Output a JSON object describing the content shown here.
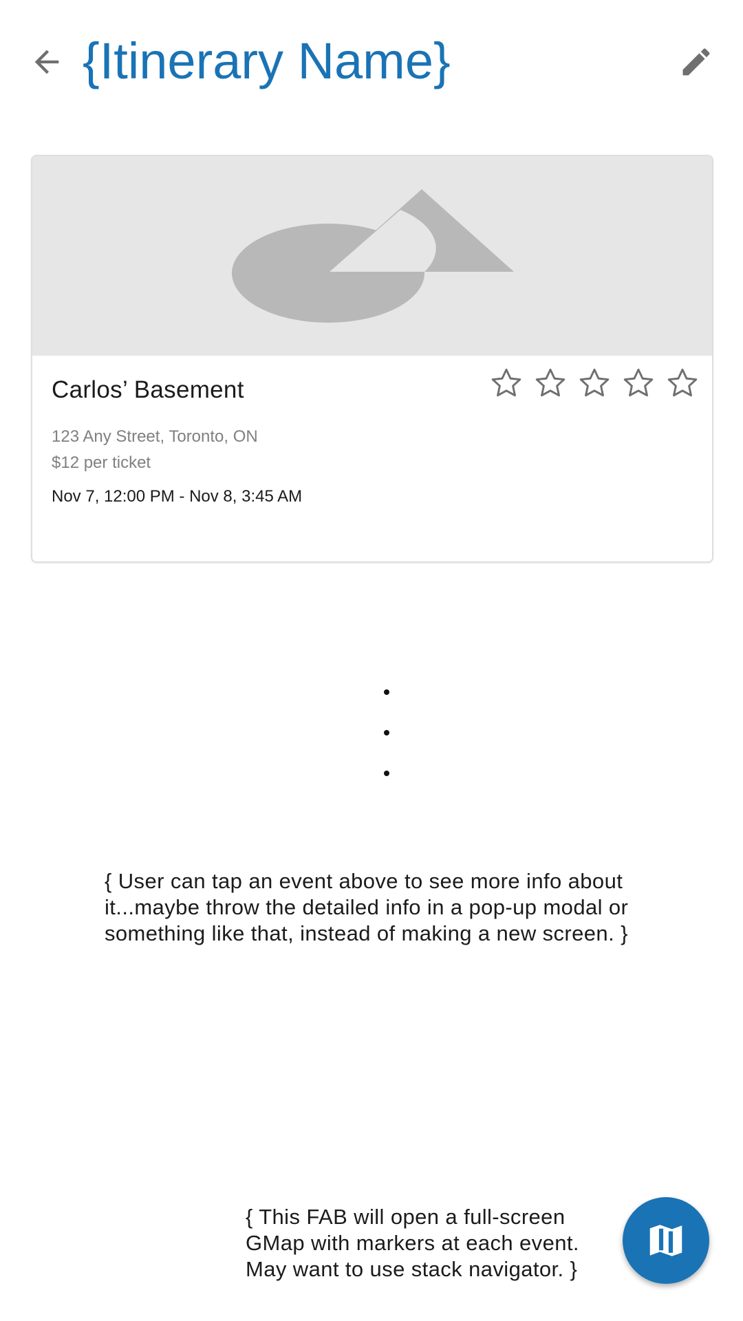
{
  "header": {
    "title": "{Itinerary Name}",
    "back_icon": "arrow-back-icon",
    "edit_icon": "pencil-icon"
  },
  "event_card": {
    "name": "Carlos’ Basement",
    "address": "123 Any Street, Toronto, ON",
    "price": "$12 per ticket",
    "dates": "Nov 7, 12:00 PM - Nov 8, 3:45 AM",
    "rating": {
      "value": 0,
      "max": 5
    },
    "media_icon": "image-placeholder-icon"
  },
  "notes": {
    "tap_event": "{ User can tap an event above to see more info about it...maybe throw the detailed info in a pop-up modal or something like that, instead of making a new screen. }",
    "fab": "{ This FAB will open a full-screen GMap with markers at each event. May want to use stack navigator. }"
  },
  "fab": {
    "icon": "map-icon"
  },
  "colors": {
    "accent": "#1a73b5",
    "icon_gray": "#6f6f6f",
    "placeholder_bg": "#e6e6e6",
    "placeholder_shape": "#b8b8b8"
  }
}
